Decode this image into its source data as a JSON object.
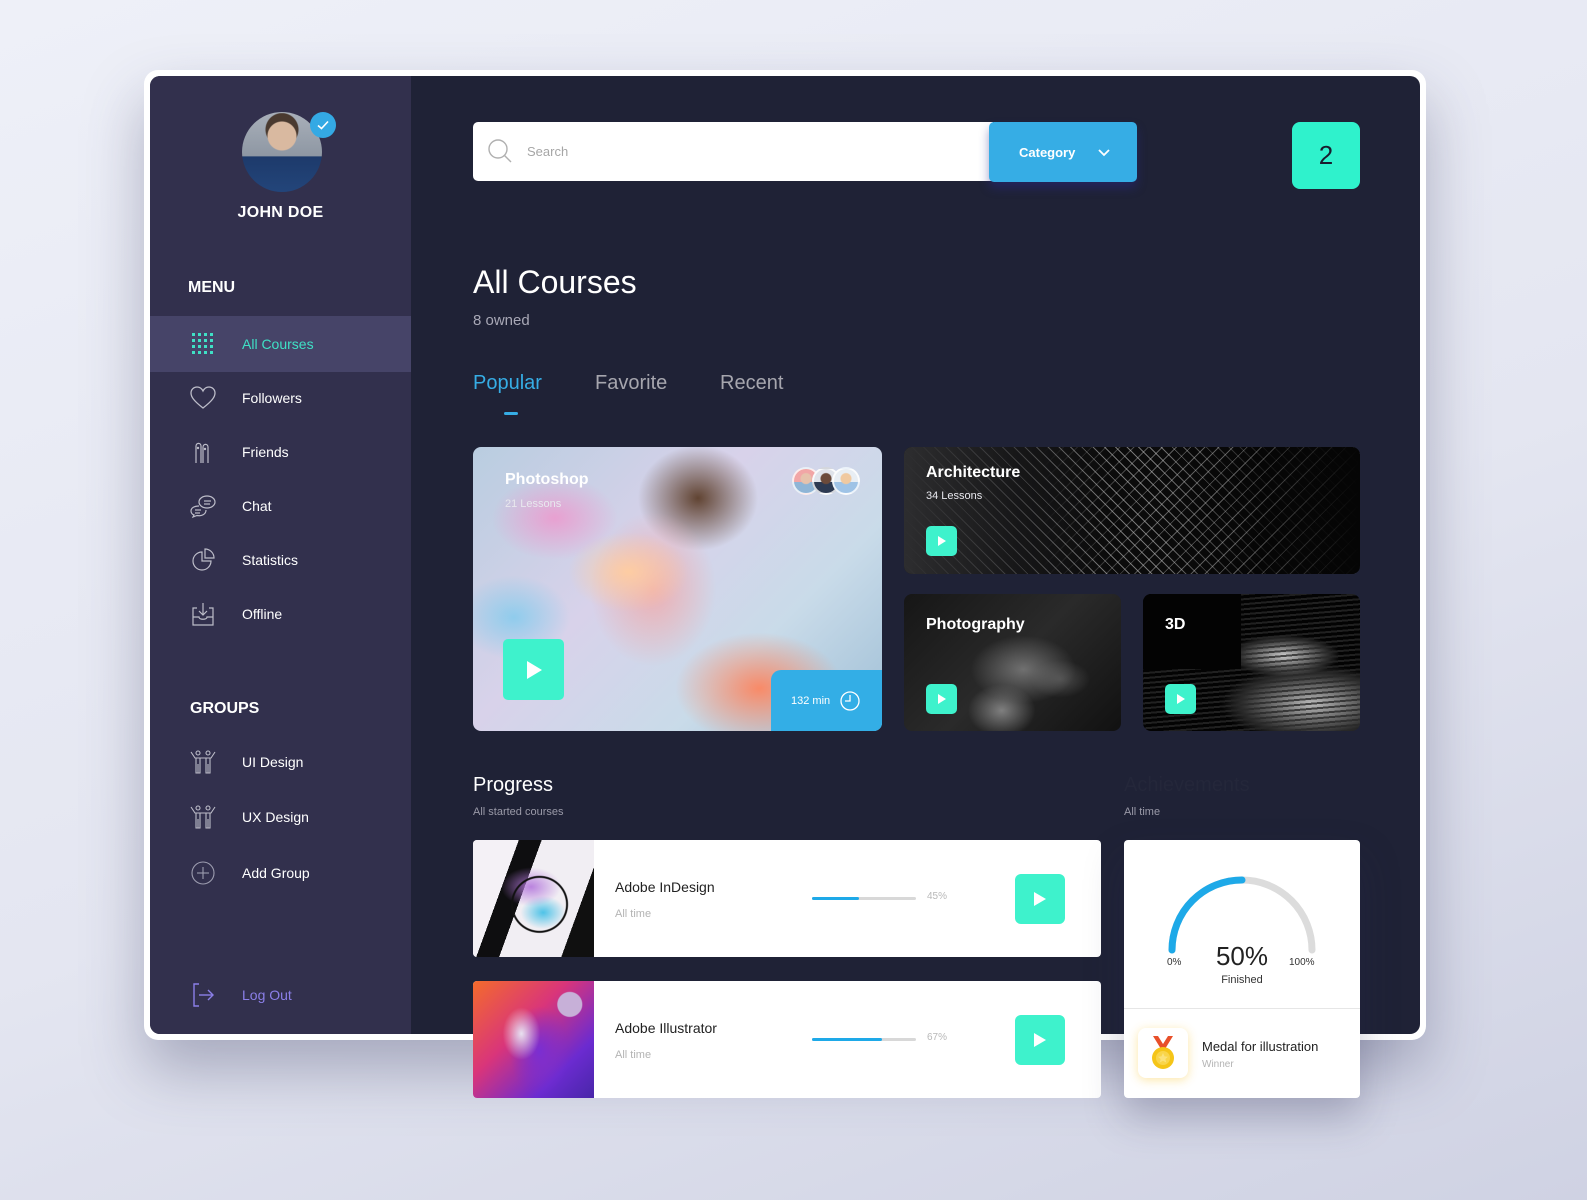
{
  "user": {
    "name": "JOHN DOE",
    "verified": true
  },
  "sidebar": {
    "menu_title": "MENU",
    "menu_items": [
      {
        "label": "All Courses",
        "icon": "grid-icon",
        "active": true
      },
      {
        "label": "Followers",
        "icon": "heart-icon"
      },
      {
        "label": "Friends",
        "icon": "friends-icon"
      },
      {
        "label": "Chat",
        "icon": "chat-icon"
      },
      {
        "label": "Statistics",
        "icon": "pie-chart-icon"
      },
      {
        "label": "Offline",
        "icon": "download-tray-icon"
      }
    ],
    "groups_title": "GROUPS",
    "group_items": [
      {
        "label": "UI Design",
        "icon": "group-people-icon"
      },
      {
        "label": "UX Design",
        "icon": "group-people-icon"
      },
      {
        "label": "Add Group",
        "icon": "plus-circle-icon"
      }
    ],
    "logout_label": "Log Out"
  },
  "header": {
    "search_placeholder": "Search",
    "search_value": "",
    "category_label": "Category",
    "notification_count": "2"
  },
  "main": {
    "title": "All Courses",
    "subtitle": "8 owned",
    "tabs": [
      {
        "label": "Popular",
        "active": true
      },
      {
        "label": "Favorite"
      },
      {
        "label": "Recent"
      }
    ],
    "courses": [
      {
        "title": "Photoshop",
        "lessons": "21 Lessons",
        "duration": "132 min"
      },
      {
        "title": "Architecture",
        "lessons": "34 Lessons"
      },
      {
        "title": "Photography"
      },
      {
        "title": "3D"
      }
    ]
  },
  "progress": {
    "title": "Progress",
    "subtitle": "All started courses",
    "items": [
      {
        "name": "Adobe InDesign",
        "period": "All time",
        "percent": 45,
        "percent_label": "45%"
      },
      {
        "name": "Adobe Illustrator",
        "period": "All time",
        "percent": 67,
        "percent_label": "67%"
      }
    ]
  },
  "achievements": {
    "title": "Achievements",
    "subtitle": "All time",
    "finished_percent": 50,
    "finished_label": "50%",
    "finished_caption": "Finished",
    "min_label": "0%",
    "max_label": "100%",
    "medal_title": "Medal for illustration",
    "medal_subtitle": "Winner"
  },
  "colors": {
    "accent_teal": "#3ef2cc",
    "accent_blue": "#36ade5",
    "sidebar_bg": "#32304d",
    "main_bg": "#1f2236",
    "logout": "#8b7fe8"
  }
}
